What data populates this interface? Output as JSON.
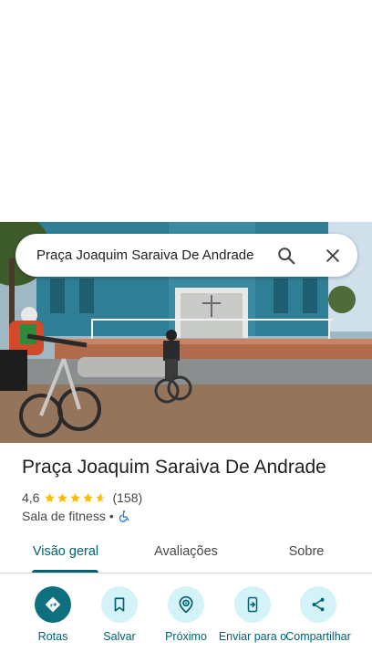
{
  "search": {
    "query": "Praça Joaquim Saraiva De Andrade",
    "search_icon": "search-icon",
    "close_icon": "close-icon"
  },
  "place": {
    "title": "Praça Joaquim Saraiva De Andrade",
    "rating": "4,6",
    "rating_stars": 4.6,
    "review_count": "(158)",
    "category": "Sala de fitness",
    "separator": "•",
    "accessibility_icon": "wheelchair-icon"
  },
  "tabs": [
    {
      "label": "Visão geral",
      "active": true
    },
    {
      "label": "Avaliações",
      "active": false
    },
    {
      "label": "Sobre",
      "active": false
    }
  ],
  "actions": [
    {
      "label": "Rotas",
      "icon": "directions-icon"
    },
    {
      "label": "Salvar",
      "icon": "bookmark-icon"
    },
    {
      "label": "Próximo",
      "icon": "nearby-icon"
    },
    {
      "label": "Enviar para o",
      "icon": "send-to-phone-icon"
    },
    {
      "label": "Compartilhar",
      "icon": "share-icon"
    }
  ],
  "colors": {
    "accent": "#00616f",
    "primary_button": "#0e6f7e",
    "tonal_button": "#d4f3f8",
    "star": "#fbbc04"
  }
}
